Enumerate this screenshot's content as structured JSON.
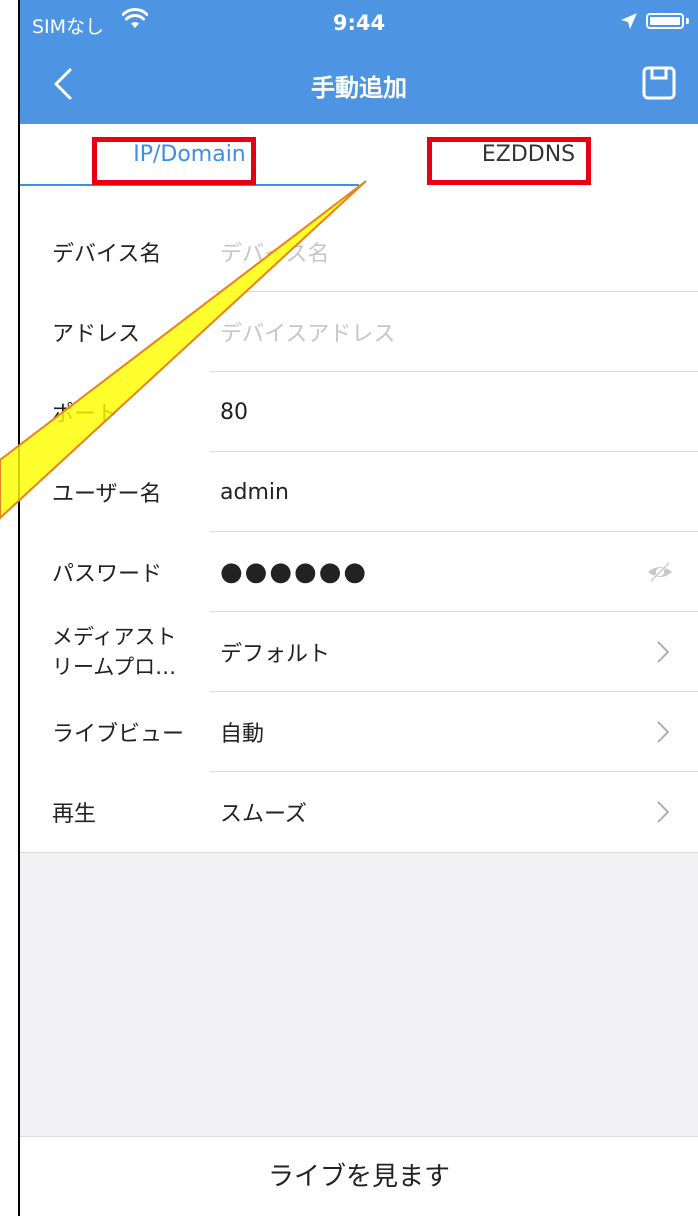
{
  "status_bar": {
    "carrier": "SIMなし",
    "time": "9:44"
  },
  "nav": {
    "title": "手動追加",
    "icons": {
      "back": "chevron-left-icon",
      "save": "save-icon"
    }
  },
  "tabs": [
    {
      "label": "IP/Domain",
      "selected": true
    },
    {
      "label": "EZDDNS",
      "selected": false
    }
  ],
  "form": {
    "rows": [
      {
        "label": "デバイス名",
        "value": "",
        "placeholder": "デバイス名"
      },
      {
        "label": "アドレス",
        "value": "",
        "placeholder": "デバイスアドレス"
      },
      {
        "label": "ポート",
        "value": "80"
      },
      {
        "label": "ユーザー名",
        "value": "admin"
      },
      {
        "label": "パスワード",
        "value": "●●●●●●",
        "icon": "eye-slash-icon"
      },
      {
        "label": "メディアスト\nリームプロ…",
        "value": "デフォルト",
        "icon": "chevron-right-icon"
      },
      {
        "label": "ライブビュー",
        "value": "自動",
        "icon": "chevron-right-icon"
      },
      {
        "label": "再生",
        "value": "スムーズ",
        "icon": "chevron-right-icon"
      }
    ]
  },
  "bottom": {
    "button_label": "ライブを見ます"
  },
  "colors": {
    "accent": "#4d95e3",
    "tab_active": "#3d8ee6",
    "highlight_box": "#e60012",
    "callout_fill": "#ffff00",
    "callout_stroke": "#e8821e"
  }
}
